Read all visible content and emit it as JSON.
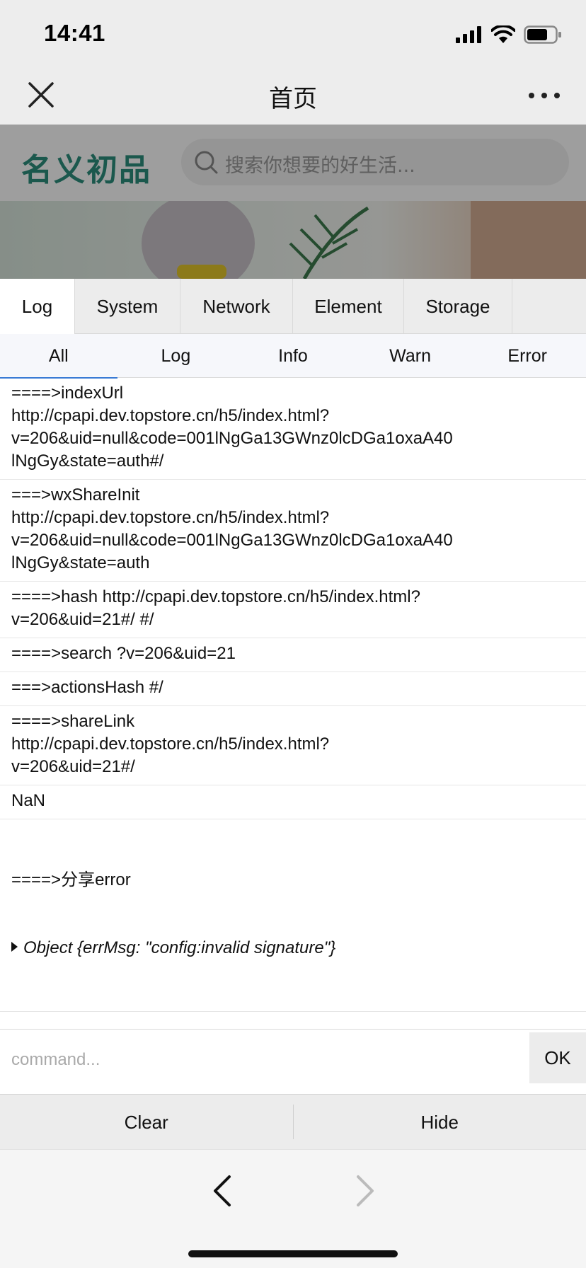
{
  "status_bar": {
    "time": "14:41"
  },
  "nav_bar": {
    "title": "首页"
  },
  "webpage": {
    "logo_text": "名义初品",
    "search_placeholder": "搜索你想要的好生活..."
  },
  "console": {
    "tabs": [
      {
        "label": "Log",
        "active": true
      },
      {
        "label": "System",
        "active": false
      },
      {
        "label": "Network",
        "active": false
      },
      {
        "label": "Element",
        "active": false
      },
      {
        "label": "Storage",
        "active": false
      }
    ],
    "subtabs": [
      {
        "label": "All",
        "active": true
      },
      {
        "label": "Log",
        "active": false
      },
      {
        "label": "Info",
        "active": false
      },
      {
        "label": "Warn",
        "active": false
      },
      {
        "label": "Error",
        "active": false
      }
    ],
    "logs": [
      {
        "text": "====>indexUrl\nhttp://cpapi.dev.topstore.cn/h5/index.html?\nv=206&uid=null&code=001lNgGa13GWnz0lcDGa1oxaA40\nlNgGy&state=auth#/"
      },
      {
        "text": "===>wxShareInit\nhttp://cpapi.dev.topstore.cn/h5/index.html?\nv=206&uid=null&code=001lNgGa13GWnz0lcDGa1oxaA40\nlNgGy&state=auth"
      },
      {
        "text": "====>hash http://cpapi.dev.topstore.cn/h5/index.html?\nv=206&uid=21#/ #/"
      },
      {
        "text": "====>search ?v=206&uid=21"
      },
      {
        "text": "===>actionsHash #/"
      },
      {
        "text": "====>shareLink\nhttp://cpapi.dev.topstore.cn/h5/index.html?\nv=206&uid=21#/"
      },
      {
        "text": "NaN"
      }
    ],
    "error_log": {
      "text": "====>分享error",
      "object": "Object {errMsg: \"config:invalid signature\"}"
    },
    "command_placeholder": "command...",
    "ok_label": "OK",
    "clear_label": "Clear",
    "hide_label": "Hide"
  }
}
